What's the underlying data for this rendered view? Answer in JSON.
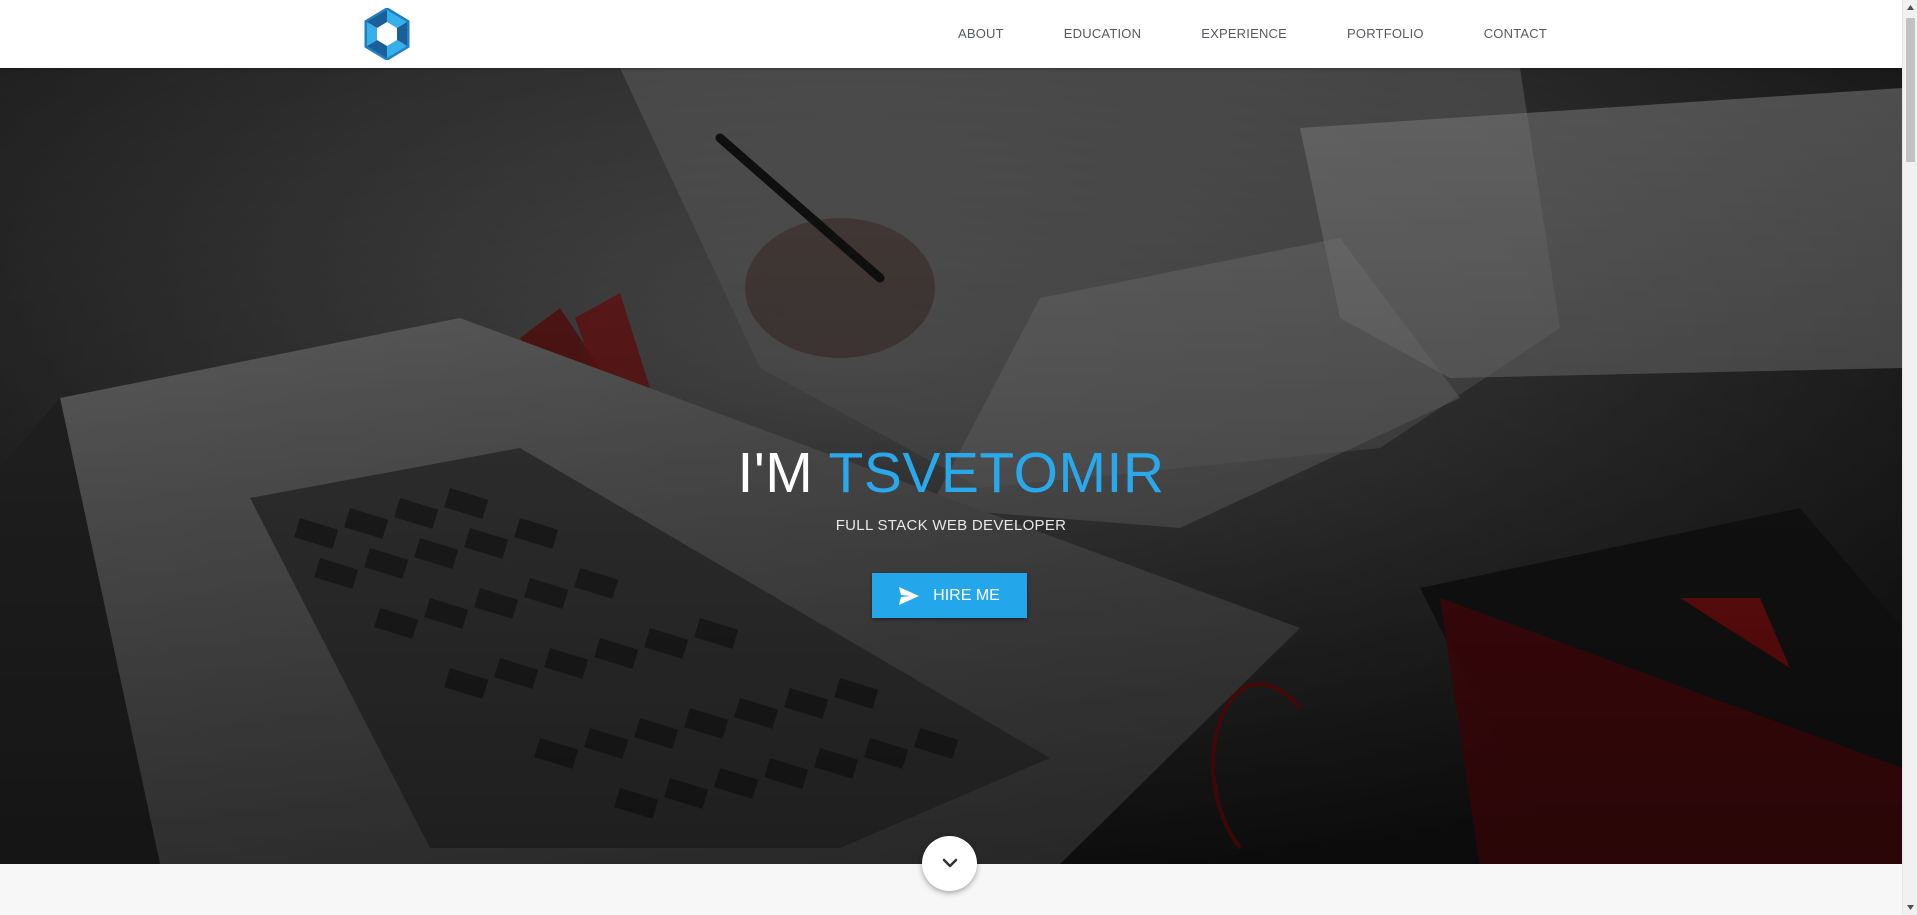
{
  "nav": {
    "logo_icon": "hexagon-logo-icon",
    "items": [
      {
        "label": "ABOUT"
      },
      {
        "label": "EDUCATION"
      },
      {
        "label": "EXPERIENCE"
      },
      {
        "label": "PORTFOLIO"
      },
      {
        "label": "CONTACT"
      }
    ]
  },
  "hero": {
    "title_prefix": "I'M ",
    "title_name": "TSVETOMIR",
    "subtitle": "FULL STACK WEB DEVELOPER",
    "cta_label": "HIRE ME",
    "cta_icon": "send-icon",
    "scroll_icon": "chevron-down-icon"
  },
  "colors": {
    "accent": "#29a9ec",
    "button": "#24a6ea",
    "nav_text": "#555b60"
  }
}
